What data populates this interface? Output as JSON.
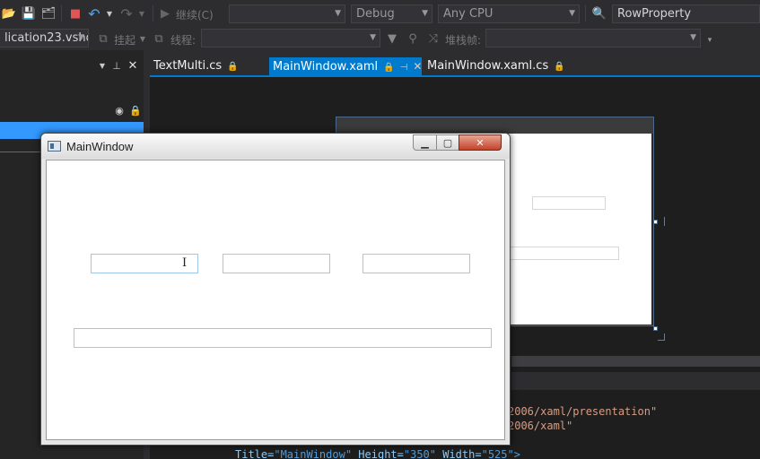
{
  "toolbar": {
    "continue_label": "继续(C)",
    "config_value": "Debug",
    "platform_value": "Any CPU",
    "find_value": "RowProperty",
    "project_value": "lication23.vsho",
    "suspend_label": "挂起",
    "thread_label": "线程:",
    "stackframe_label": "堆栈帧:"
  },
  "tabs": [
    {
      "label": "TextMulti.cs"
    },
    {
      "label": "MainWindow.xaml",
      "active": true
    },
    {
      "label": "MainWindow.xaml.cs"
    }
  ],
  "app_window": {
    "title": "MainWindow"
  },
  "code": {
    "line1": "2006/xaml/presentation\"",
    "line2": "2006/xaml\"",
    "line3_title_attr": "Title=",
    "line3_title_val": "\"MainWindow\"",
    "line3_height_attr": "Height=",
    "line3_height_val": "\"350\"",
    "line3_width_attr": "Width=",
    "line3_width_val": "\"525\"",
    "line3_end": ">"
  },
  "colors": {
    "accent": "#007acc",
    "selection": "#3399ff",
    "toolbar_bg": "#2d2d30",
    "editor_bg": "#1e1e1e",
    "close_red": "#c2432a"
  }
}
